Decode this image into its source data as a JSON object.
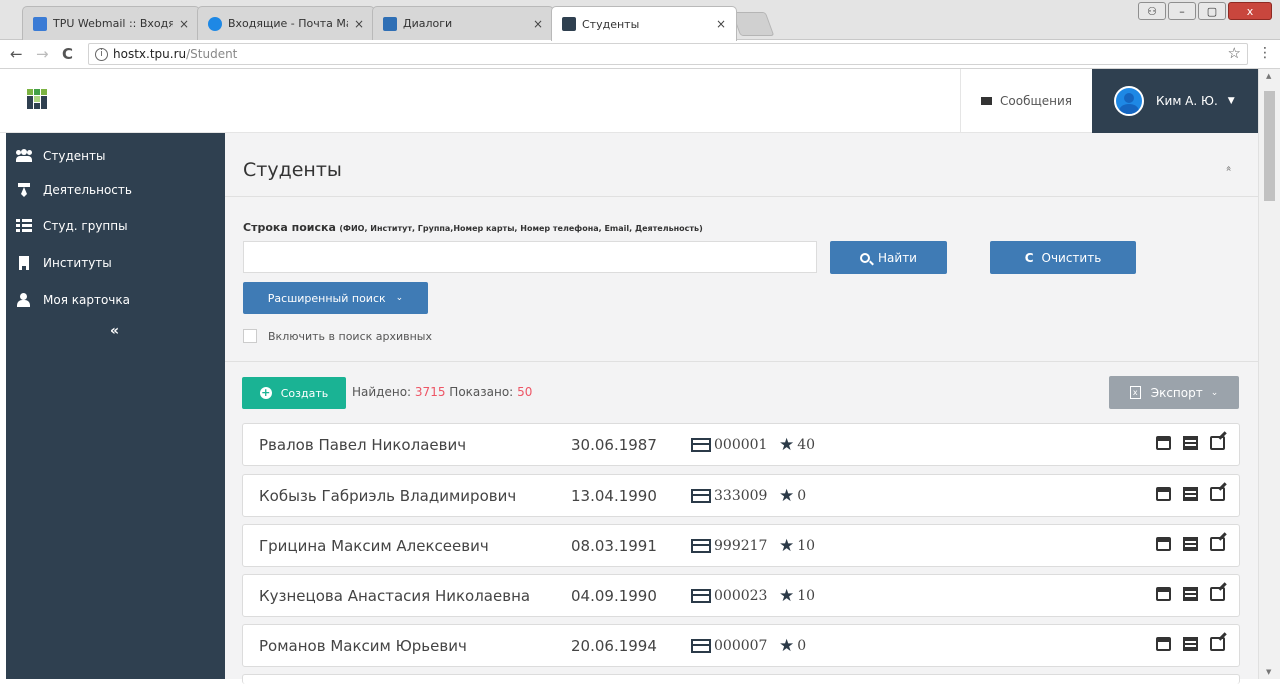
{
  "browser": {
    "tabs": [
      {
        "title": "TPU Webmail :: Входящи",
        "fav_color": "#3a7bd5"
      },
      {
        "title": "Входящие - Почта Mail.",
        "fav_color": "#1e88e5"
      },
      {
        "title": "Диалоги",
        "fav_color": "#2f6fb5"
      },
      {
        "title": "Студенты",
        "fav_color": "#2f4050"
      }
    ],
    "close_glyph": "×",
    "url_host": "hostx.tpu.ru",
    "url_path": "/Student",
    "back": "←",
    "forward": "→",
    "reload": "C",
    "bookmark": "☆",
    "menu": "⋮",
    "window_buttons": {
      "minimize": "–",
      "maximize": "▢",
      "close": "x"
    }
  },
  "header": {
    "messages_label": "Сообщения",
    "user_label": "Ким А. Ю.",
    "caret": "▼"
  },
  "sidebar": {
    "items": [
      {
        "label": "Студенты",
        "icon": "users-icon"
      },
      {
        "label": "Деятельность",
        "icon": "tie-icon"
      },
      {
        "label": "Студ. группы",
        "icon": "table-icon"
      },
      {
        "label": "Институты",
        "icon": "building-icon"
      },
      {
        "label": "Моя карточка",
        "icon": "user-icon"
      }
    ],
    "collapse_glyph": "«"
  },
  "main": {
    "title": "Студенты",
    "collapse_glyph": "»",
    "search": {
      "label": "Строка поиска",
      "hint": "(ФИО, Институт, Группа,Номер карты, Номер телефона, Email, Деятельность)",
      "value": "",
      "find_label": "Найти",
      "clear_label": "Очистить",
      "advanced_label": "Расширенный поиск",
      "archive_label": "Включить в поиск архивных"
    },
    "toolbar": {
      "create_label": "Создать",
      "found_label": "Найдено:",
      "found_count": "3715",
      "shown_label": "Показано:",
      "shown_count": "50",
      "export_label": "Экспорт"
    },
    "students": [
      {
        "name": "Рвалов Павел Николаевич",
        "dob": "30.06.1987",
        "card": "000001",
        "rating": "40"
      },
      {
        "name": "Кобызь Габриэль Владимирович",
        "dob": "13.04.1990",
        "card": "333009",
        "rating": "0"
      },
      {
        "name": "Грицина Максим Алексеевич",
        "dob": "08.03.1991",
        "card": "999217",
        "rating": "10"
      },
      {
        "name": "Кузнецова Анастасия Николаевна",
        "dob": "04.09.1990",
        "card": "000023",
        "rating": "10"
      },
      {
        "name": "Романов Максим Юрьевич",
        "dob": "20.06.1994",
        "card": "000007",
        "rating": "0"
      }
    ]
  },
  "colors": {
    "sidebar_bg": "#2f4050",
    "primary": "#3f7bb5",
    "create": "#1ab394",
    "export": "#9ba3ab",
    "count_accent": "#ed5565"
  }
}
